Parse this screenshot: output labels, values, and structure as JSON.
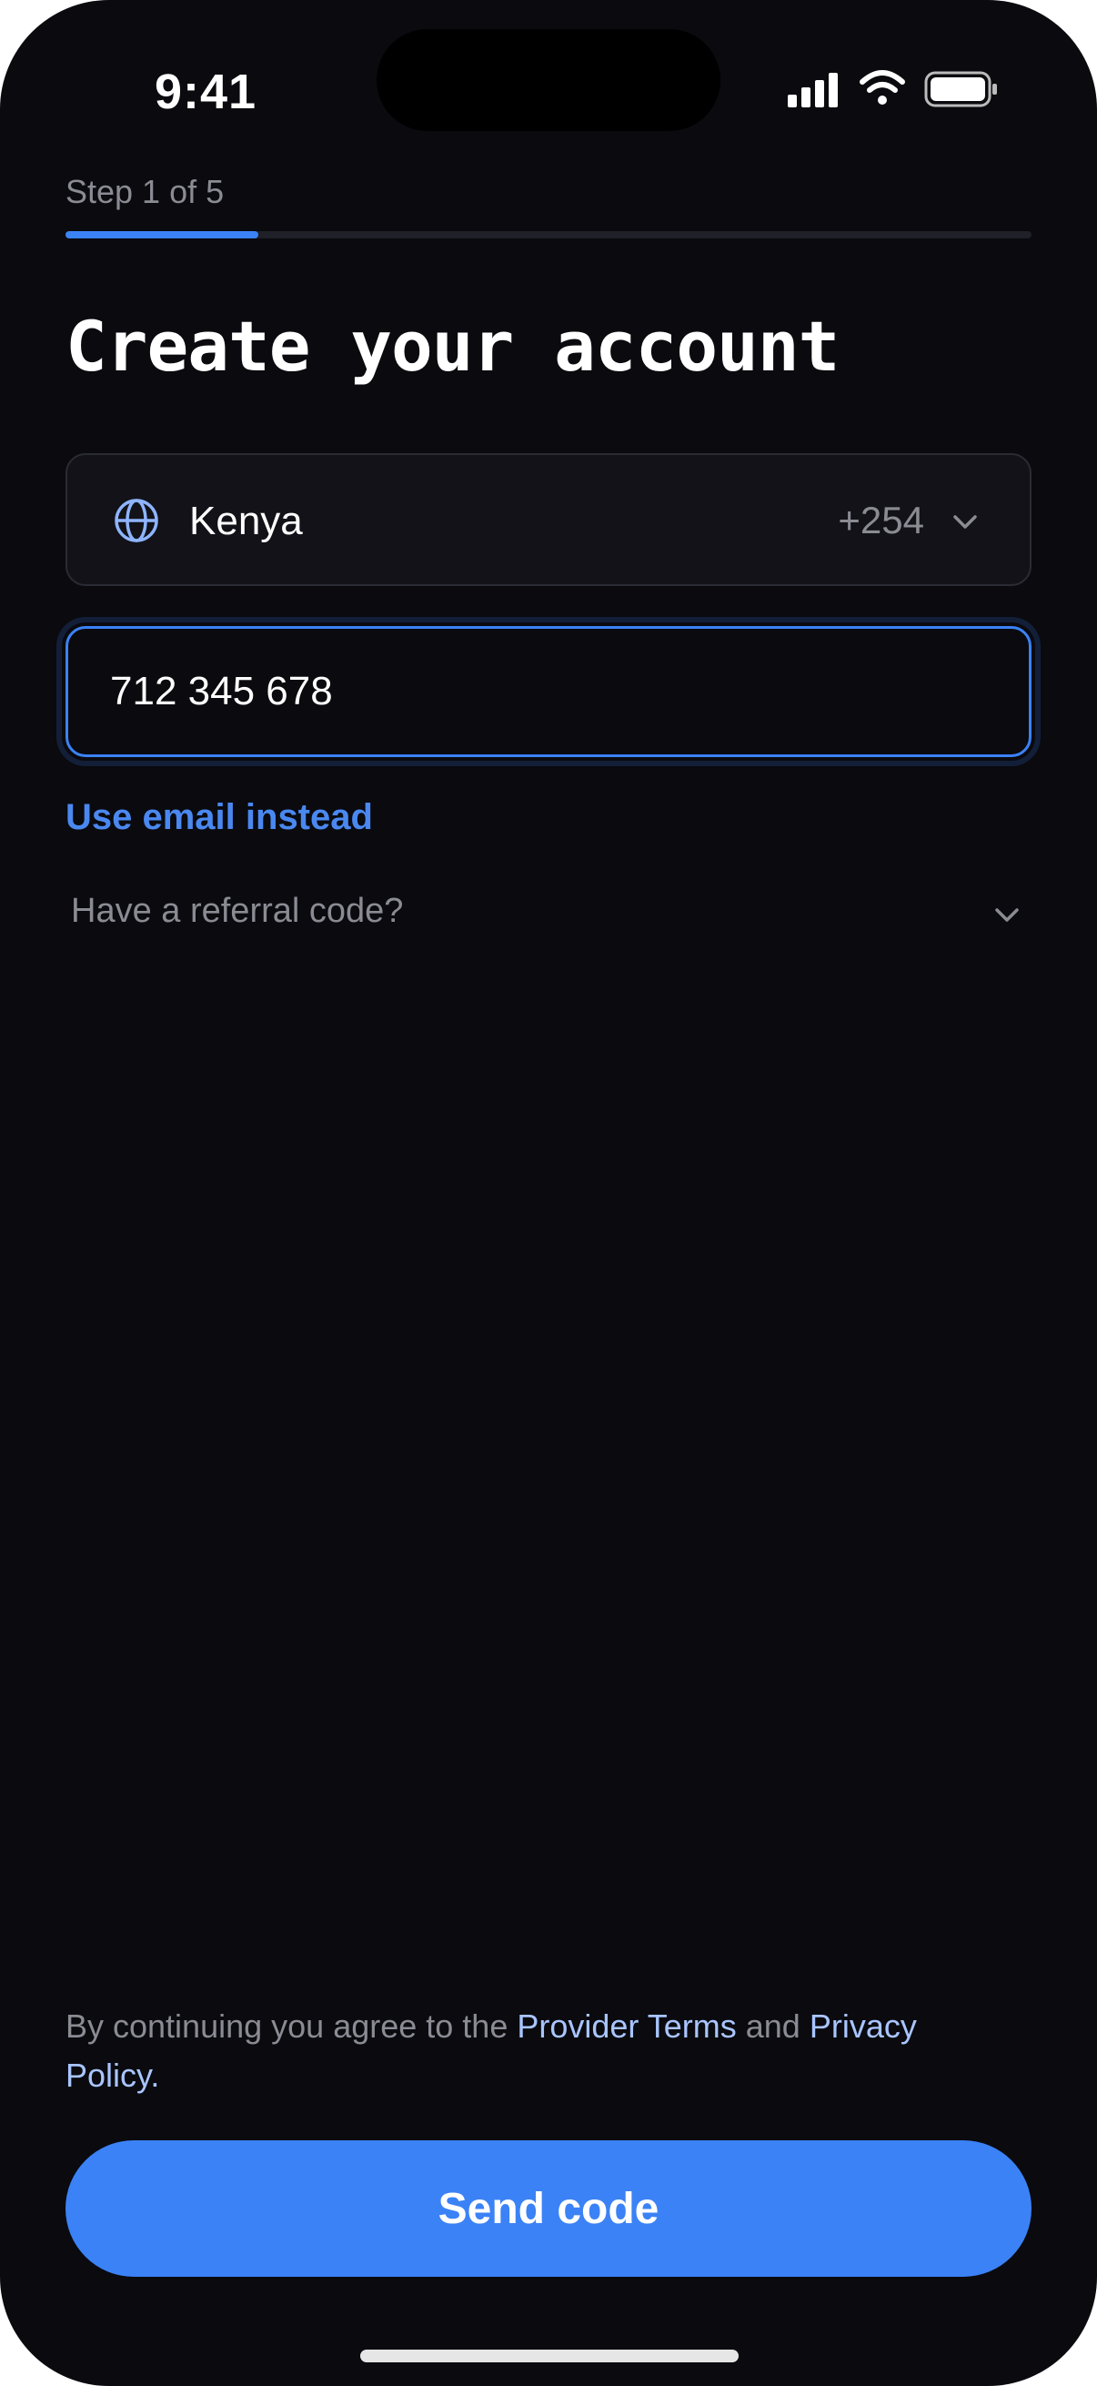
{
  "status_bar": {
    "time": "9:41",
    "icons": [
      "signal-icon",
      "wifi-icon",
      "battery-icon"
    ]
  },
  "progress": {
    "label": "Step 1 of 5",
    "current_step": 1,
    "total_steps": 5,
    "fraction": 0.2
  },
  "title": "Create your account",
  "country": {
    "icon": "globe-icon",
    "name": "Kenya",
    "dial_code": "+254"
  },
  "phone": {
    "value": "712 345 678"
  },
  "email_link": "Use email instead",
  "referral": {
    "label": "Have a referral code?"
  },
  "terms": {
    "prefix": "By continuing you agree to the ",
    "provider_terms": "Provider Terms",
    "conjunction": " and ",
    "privacy_policy": "Privacy Policy",
    "suffix": "."
  },
  "send_button": "Send code",
  "colors": {
    "background": "#0a0a0f",
    "accent": "#3b82f6",
    "link": "#a9c5ff",
    "muted_text": "#8a8b93"
  }
}
